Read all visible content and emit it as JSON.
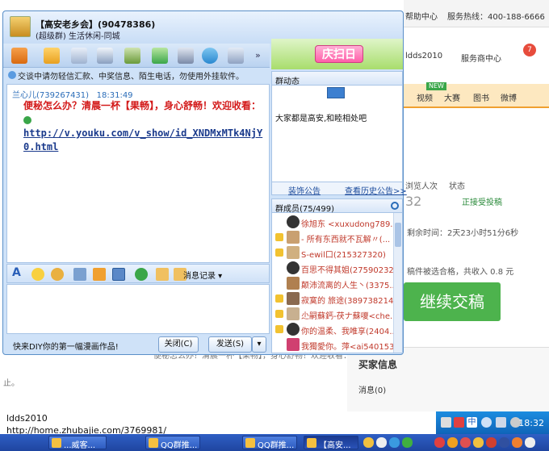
{
  "background_page": {
    "topbar": {
      "help": "帮助中心",
      "hotline": "服务热线：400-188-6666"
    },
    "nav": {
      "user": "ldds2010",
      "service": "服务商中心",
      "badge": "7"
    },
    "categories": {
      "new_tag": "NEW",
      "items": [
        "视频",
        "大赛",
        "图书",
        "微博"
      ]
    },
    "stats": {
      "viewers_label": "浏览人次",
      "viewers_value": "32",
      "status_label": "状态",
      "status_value": "正接受投稿",
      "remaining": "剩余时间：2天23小时51分6秒"
    },
    "reward_text": "稿件被选合格，共收入 0.8 元",
    "submit_button": "继续交稿",
    "buyer_info": {
      "title": "买家信息",
      "messages": "消息(0)"
    },
    "echo_text": "便秘怎么办？清晨一杯【果畅】，身心舒畅！欢迎收看：  http://v.youku.com/v_show/id_XNDMxMTk4NjY0.",
    "echo_tail": "止。"
  },
  "qq_window": {
    "title": "【高安老乡会】(90478386)",
    "subtitle": "(超级群) 生活休闲-同城",
    "notice": "交谈中请勿轻信汇款、中奖信息、陌生电话，勿使用外挂软件。",
    "message": {
      "sender": "兰心儿(739267431)",
      "time": "18:31:49",
      "text": "便秘怎么办？清晨一杯【果畅】，身心舒畅！欢迎收看：",
      "link": "http://v.youku.com/v_show/id_XNDMxMTk4NjY0.html"
    },
    "format_bar": {
      "record_label": "消息记录"
    },
    "bottom": {
      "ad_text": "快来DIY你的第一幅漫画作品!",
      "close_label": "关闭(C)",
      "send_label": "发送(S)"
    },
    "right_panel": {
      "promo_label": "庆扫日",
      "dynamics_title": "群动态",
      "dynamics_text": "大家都是高安,和睦相处吧",
      "decorate_link": "装饰公告",
      "history_link": "查看历史公告>>",
      "members_title": "群成员(75/499)",
      "members": [
        {
          "text": "徐旭东 <xuxudong789..."
        },
        {
          "text": "- 所有东西就不瓦解〃(..."
        },
        {
          "text": "S-ewil口(215327320)"
        },
        {
          "text": "百思不得其姐(275902329)"
        },
        {
          "text": "颠沛流离的人生丶(3375..."
        },
        {
          "text": "寂寞的 旅途(389738214)"
        },
        {
          "text": "尐嗣蘇鈣-茯ナ蘇嗄<che..."
        },
        {
          "text": "你的温柔、我唯享(2404..."
        },
        {
          "text": "我獨愛你。萍<ai540153..."
        }
      ]
    }
  },
  "taskbar": {
    "user": "ldds2010",
    "url": "http://home.zhubajie.com/3769981/",
    "tasks": [
      "...威客...",
      "QQ群推...",
      "QQ群推...",
      "【高安..."
    ],
    "time": "18:32"
  },
  "colors": {
    "window_bg": "#cfe2f8",
    "message_red": "#d31a1a",
    "link_blue": "#1a3a8c",
    "submit_green": "#4db34d",
    "taskbar_blue": "#2a4ea8"
  }
}
